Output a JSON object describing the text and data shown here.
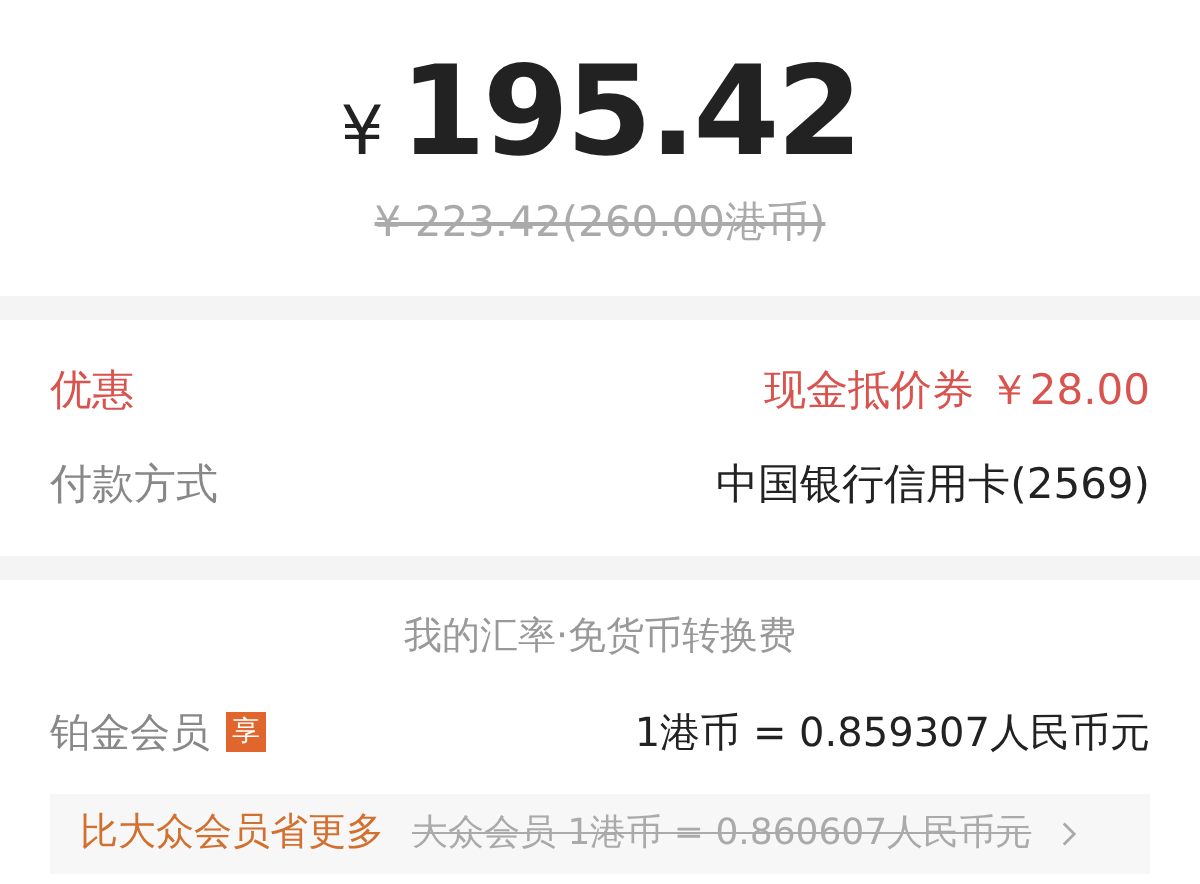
{
  "price": {
    "currency": "¥",
    "amount": "195.42",
    "original": "¥ 223.42(260.00港币)"
  },
  "details": [
    {
      "label": "优惠",
      "value": "现金抵价券 ￥28.00",
      "kind": "discount"
    },
    {
      "label": "付款方式",
      "value": "中国银行信用卡(2569)",
      "kind": "plain"
    }
  ],
  "exchange": {
    "title": "我的汇率·免货币转换费",
    "member": "铂金会员",
    "badge": "享",
    "rate": "1港币 = 0.859307人民币元",
    "compare_label": "比大众会员省更多",
    "compare_rate": "大众会员 1港币 = 0.860607人民币元"
  }
}
